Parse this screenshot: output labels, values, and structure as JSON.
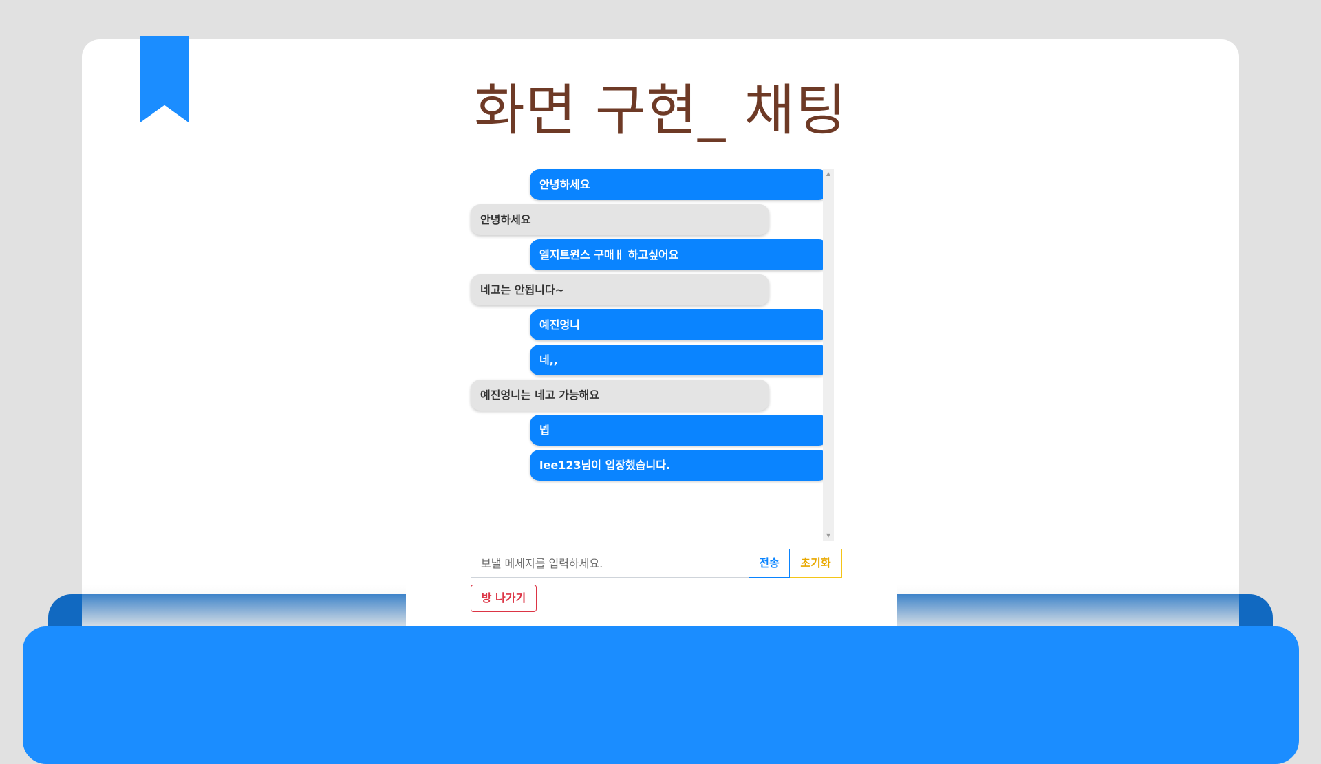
{
  "slide": {
    "title": "화면 구현_ 채팅",
    "accent_color": "#1b8dff",
    "title_color": "#6e3a26",
    "bookmark_icon": "bookmark-icon"
  },
  "chat": {
    "messages": [
      {
        "type": "sent",
        "text": "안녕하세요"
      },
      {
        "type": "received",
        "text": "안녕하세요"
      },
      {
        "type": "sent",
        "text": "엘지트윈스 구매ㅐ 하고싶어요"
      },
      {
        "type": "received",
        "text": "네고는 안됩니다~"
      },
      {
        "type": "sent",
        "text": "예진엉니"
      },
      {
        "type": "sent",
        "text": "네,,"
      },
      {
        "type": "received",
        "text": "예진엉니는 네고 가능해요"
      },
      {
        "type": "sent",
        "text": "넵"
      },
      {
        "type": "sent",
        "text": "lee123님이 입장했습니다."
      }
    ],
    "sent_color": "#0a84ff",
    "received_color": "#e4e4e4"
  },
  "controls": {
    "input_placeholder": "보낼 메세지를 입력하세요.",
    "send_label": "전송",
    "reset_label": "초기화",
    "leave_label": "방 나가기"
  }
}
